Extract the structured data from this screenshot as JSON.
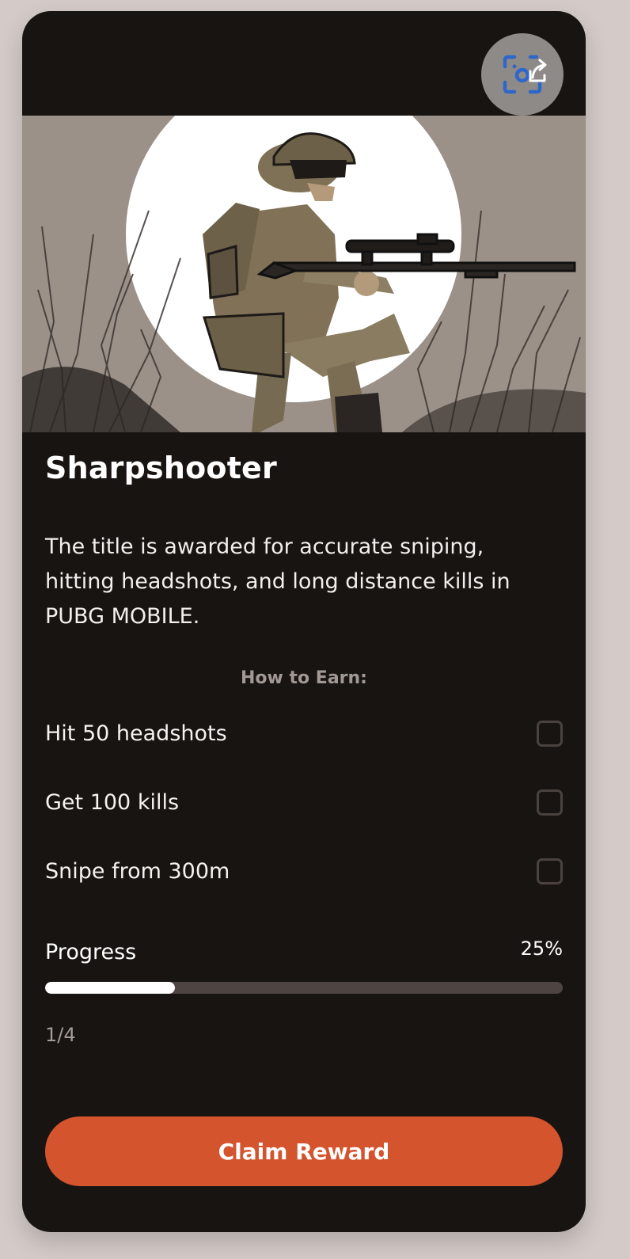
{
  "achievement": {
    "title": "Sharpshooter",
    "description": "The title is awarded for accurate sniping, hitting headshots, and long distance kills in PUBG MOBILE.",
    "hero_image": "soldier-sniper-illustration"
  },
  "earn": {
    "heading": "How to Earn:",
    "tasks": [
      {
        "label": "Hit 50 headshots",
        "checked": false
      },
      {
        "label": "Get 100 kills",
        "checked": false
      },
      {
        "label": "Snipe from 300m",
        "checked": false
      }
    ]
  },
  "progress": {
    "label": "Progress",
    "percent_text": "25%",
    "fraction": 0.25,
    "count_text": "1/4"
  },
  "actions": {
    "claim_label": "Claim Reward",
    "share_icon": "share-camera-icon"
  },
  "colors": {
    "card_background": "#171412",
    "page_background": "#d4cbc8",
    "accent": "#d4552d",
    "progress_fill": "#ffffff",
    "progress_track": "#4e4542"
  }
}
